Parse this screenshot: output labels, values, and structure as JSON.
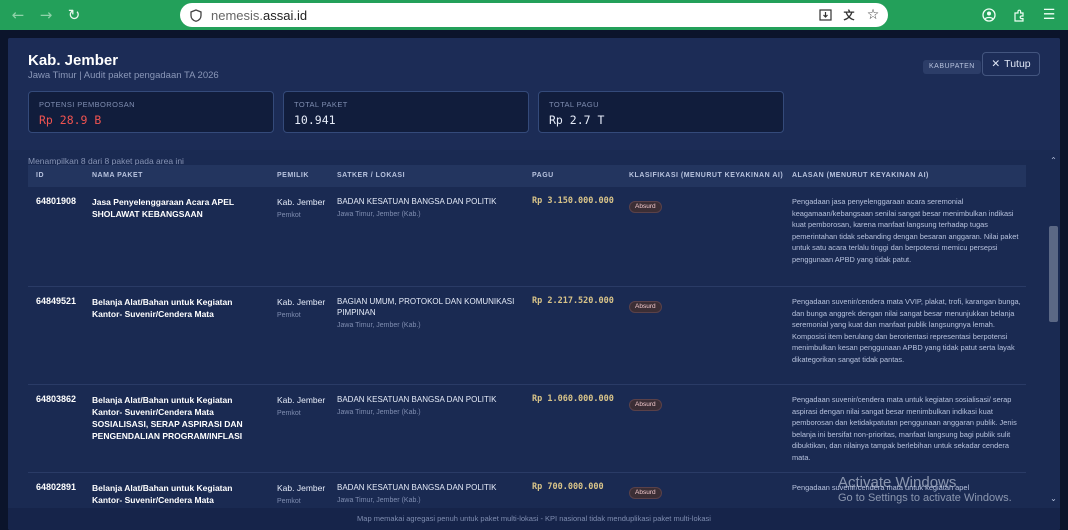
{
  "browser": {
    "url_prefix": "nemesis.",
    "url_host": "assai.id"
  },
  "header": {
    "title": "Kab. Jember",
    "subtitle": "Jawa Timur | Audit paket pengadaan TA 2026",
    "badge": "KABUPATEN",
    "close_label": "Tutup"
  },
  "stats": [
    {
      "label": "POTENSI PEMBOROSAN",
      "value": "Rp 28.9 B"
    },
    {
      "label": "TOTAL PAKET",
      "value": "10.941"
    },
    {
      "label": "TOTAL PAGU",
      "value": "Rp 2.7 T"
    }
  ],
  "showing": "Menampilkan 8 dari 8 paket pada area ini",
  "table": {
    "columns": [
      "ID",
      "NAMA PAKET",
      "PEMILIK",
      "SATKER / LOKASI",
      "PAGU",
      "KLASIFIKASI (MENURUT KEYAKINAN AI)",
      "ALASAN (MENURUT KEYAKINAN AI)"
    ],
    "rows": [
      {
        "id": "64801908",
        "name": "Jasa Penyelenggaraan Acara APEL SHOLAWAT KEBANGSAAN",
        "owner": "Kab. Jember",
        "owner_sub": "Pemkot",
        "satker": "BADAN KESATUAN BANGSA DAN POLITIK",
        "lokasi": "Jawa Timur, Jember (Kab.)",
        "pagu": "Rp 3.150.000.000",
        "klasifikasi": "Absurd",
        "alasan": "Pengadaan jasa penyelenggaraan acara seremonial keagamaan/kebangsaan senilai sangat besar menimbulkan indikasi kuat pemborosan, karena manfaat langsung terhadap tugas pemerintahan tidak sebanding dengan besaran anggaran. Nilai paket untuk satu acara terlalu tinggi dan berpotensi memicu persepsi penggunaan APBD yang tidak patut."
      },
      {
        "id": "64849521",
        "name": "Belanja Alat/Bahan untuk Kegiatan Kantor- Suvenir/Cendera Mata",
        "owner": "Kab. Jember",
        "owner_sub": "Pemkot",
        "satker": "BAGIAN UMUM, PROTOKOL DAN KOMUNIKASI PIMPINAN",
        "lokasi": "Jawa Timur, Jember (Kab.)",
        "pagu": "Rp 2.217.520.000",
        "klasifikasi": "Absurd",
        "alasan": "Pengadaan suvenir/cendera mata VVIP, plakat, trofi, karangan bunga, dan bunga anggrek dengan nilai sangat besar menunjukkan belanja seremonial yang kuat dan manfaat publik langsungnya lemah. Komposisi item berulang dan berorientasi representasi berpotensi menimbulkan kesan penggunaan APBD yang tidak patut serta layak dikategorikan sangat tidak pantas."
      },
      {
        "id": "64803862",
        "name": "Belanja Alat/Bahan untuk Kegiatan Kantor- Suvenir/Cendera Mata SOSIALISASI, SERAP ASPIRASI DAN PENGENDALIAN PROGRAM/INFLASI",
        "owner": "Kab. Jember",
        "owner_sub": "Pemkot",
        "satker": "BADAN KESATUAN BANGSA DAN POLITIK",
        "lokasi": "Jawa Timur, Jember (Kab.)",
        "pagu": "Rp 1.060.000.000",
        "klasifikasi": "Absurd",
        "alasan": "Pengadaan suvenir/cendera mata untuk kegiatan sosialisasi/ serap aspirasi dengan nilai sangat besar menimbulkan indikasi kuat pemborosan dan ketidakpatutan penggunaan anggaran publik. Jenis belanja ini bersifat non-prioritas, manfaat langsung bagi publik sulit dibuktikan, dan nilainya tampak berlebihan untuk sekadar cendera mata."
      },
      {
        "id": "64802891",
        "name": "Belanja Alat/Bahan untuk Kegiatan Kantor- Suvenir/Cendera Mata",
        "owner": "Kab. Jember",
        "owner_sub": "Pemkot",
        "satker": "BADAN KESATUAN BANGSA DAN POLITIK",
        "lokasi": "Jawa Timur, Jember (Kab.)",
        "pagu": "Rp 700.000.000",
        "klasifikasi": "Absurd",
        "alasan": "Pengadaan suvenir/cendera mata untuk kegiatan apel"
      }
    ]
  },
  "footer": "Map memakai agregasi penuh untuk paket multi-lokasi - KPI nasional tidak menduplikasi paket multi-lokasi",
  "watermark": {
    "line1": "Activate Windows",
    "line2": "Go to Settings to activate Windows."
  }
}
